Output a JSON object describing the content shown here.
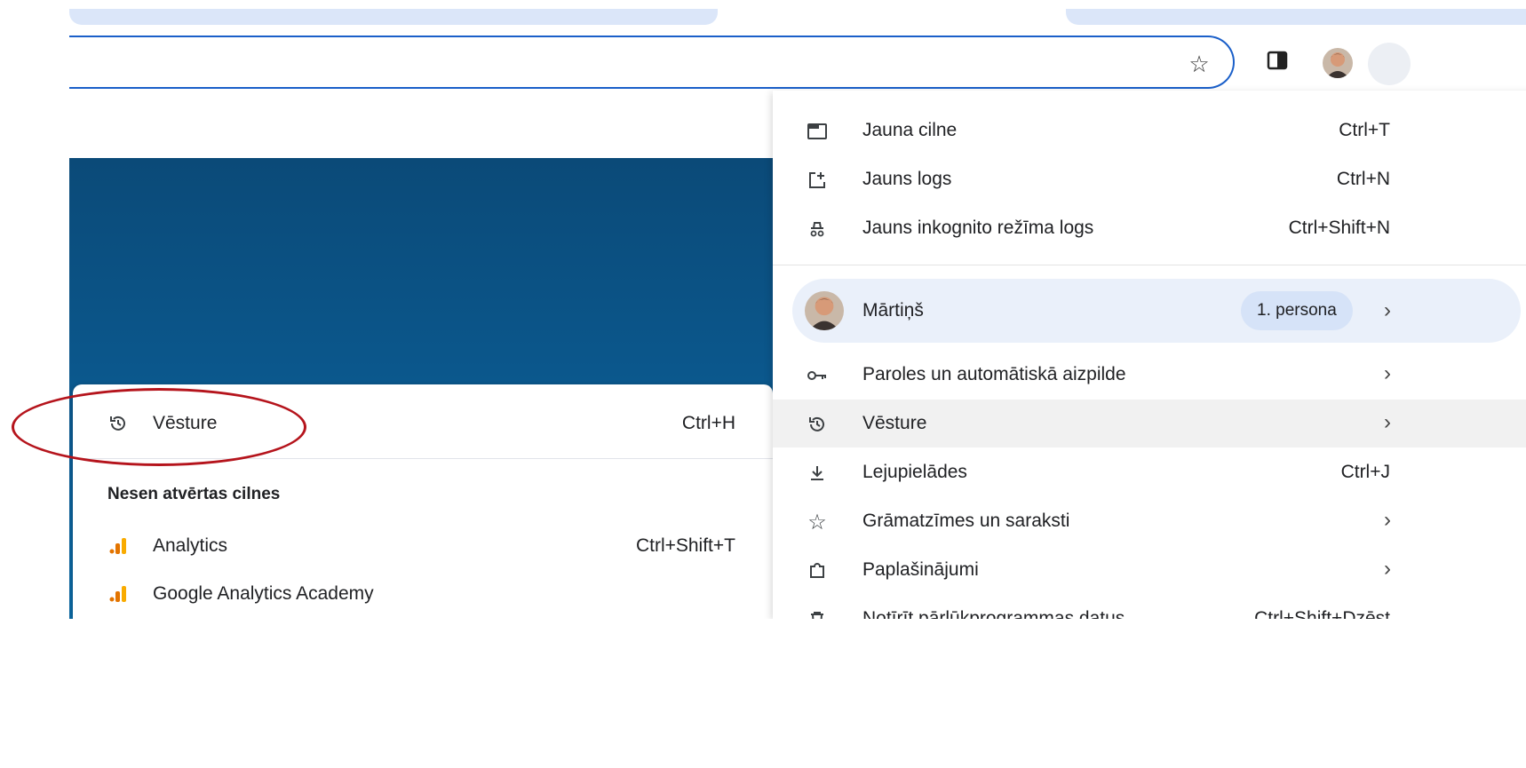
{
  "toolbar": {
    "star_icon": "☆",
    "sidepanel_icon": "side-panel-icon",
    "avatar_icon": "profile-avatar"
  },
  "submenu": {
    "history_label": "Vēsture",
    "history_shortcut": "Ctrl+H",
    "recent_heading": "Nesen atvērtas cilnes",
    "recent_items": [
      {
        "label": "Analytics",
        "shortcut": "Ctrl+Shift+T",
        "icon": "analytics-icon"
      },
      {
        "label": "Google Analytics Academy",
        "shortcut": "",
        "icon": "analytics-icon"
      }
    ]
  },
  "menu": {
    "items": [
      {
        "label": "Jauna cilne",
        "shortcut": "Ctrl+T"
      },
      {
        "label": "Jauns logs",
        "shortcut": "Ctrl+N"
      },
      {
        "label": "Jauns inkognito režīma logs",
        "shortcut": "Ctrl+Shift+N"
      },
      {
        "label": "Paroles un automātiskā aizpilde",
        "shortcut": ""
      },
      {
        "label": "Vēsture",
        "shortcut": ""
      },
      {
        "label": "Lejupielādes",
        "shortcut": "Ctrl+J"
      },
      {
        "label": "Grāmatzīmes un saraksti",
        "shortcut": ""
      },
      {
        "label": "Paplašinājumi",
        "shortcut": ""
      },
      {
        "label": "Notīrīt pārlūkprogrammas datus",
        "shortcut": "Ctrl+Shift+Dzēst"
      }
    ],
    "profile": {
      "name": "Mārtiņš",
      "badge": "1. persona"
    }
  },
  "colors": {
    "accent": "#1a5fc9",
    "highlight_ring": "#b5141c",
    "profile_bg": "#eaf0fa"
  }
}
